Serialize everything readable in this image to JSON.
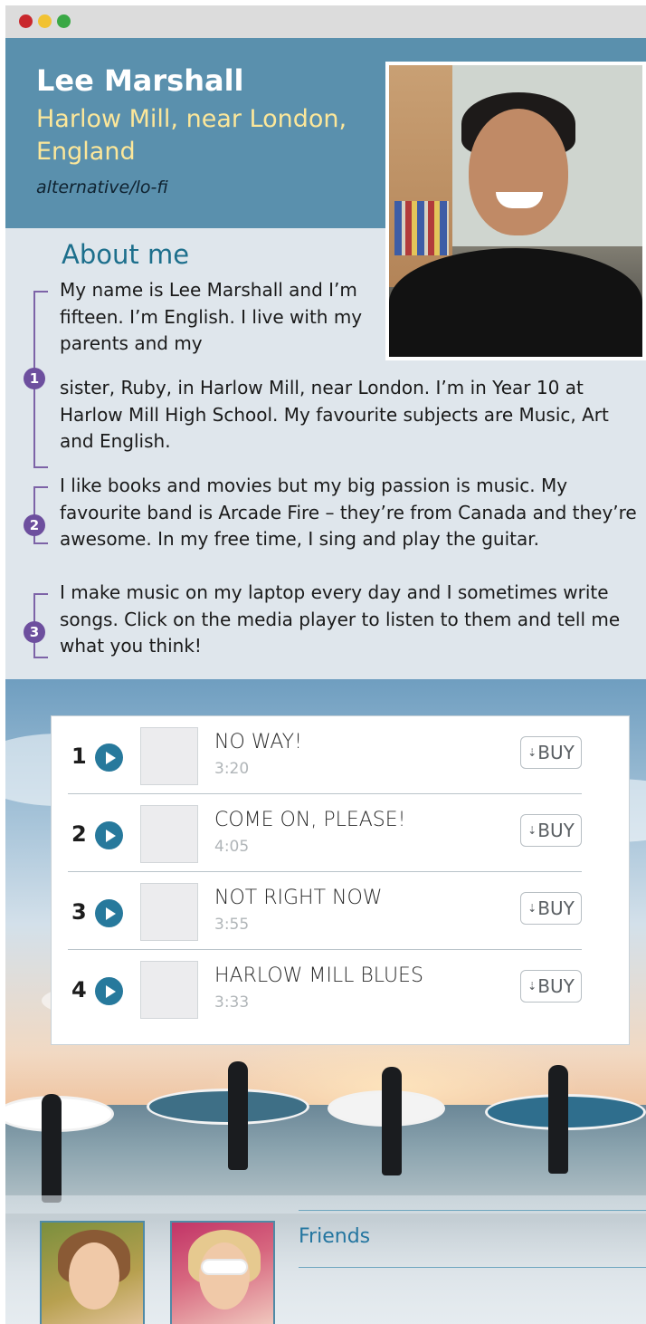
{
  "window": {
    "controls": [
      "close",
      "minimize",
      "maximize"
    ]
  },
  "profile": {
    "name": "Lee Marshall",
    "location": "Harlow Mill, near London, England",
    "genre": "alternative/lo-fi",
    "photo_icon": "profile-photo"
  },
  "about": {
    "title": "About me",
    "paragraphs": [
      {
        "number": "1",
        "text_a": "My name is Lee Marshall and I’m fifteen. I’m English. I live with my parents and my",
        "text_b": "sister, Ruby, in Harlow Mill, near London. I’m in Year 10 at Harlow Mill High School. My favourite subjects are Music, Art and English."
      },
      {
        "number": "2",
        "text": "I like books and movies but my big passion is music. My favourite band is Arcade Fire – they’re from Canada and they’re awesome. In my free time, I sing and play the guitar."
      },
      {
        "number": "3",
        "text": "I make music on my laptop every day and I sometimes write songs. Click on the media player to listen to them and tell me what you think!"
      }
    ]
  },
  "playlist": {
    "tracks": [
      {
        "number": "1",
        "title": "NO WAY!",
        "duration": "3:20",
        "buy_label": "BUY"
      },
      {
        "number": "2",
        "title": "COME ON, PLEASE!",
        "duration": "4:05",
        "buy_label": "BUY"
      },
      {
        "number": "3",
        "title": "NOT RIGHT NOW",
        "duration": "3:55",
        "buy_label": "BUY"
      },
      {
        "number": "4",
        "title": "HARLOW MILL BLUES",
        "duration": "3:33",
        "buy_label": "BUY"
      }
    ],
    "buy_arrow": "⇣"
  },
  "friends": {
    "label": "Friends",
    "photos": [
      "friend-photo-1",
      "friend-photo-2"
    ]
  },
  "colors": {
    "header_band": "#5a90ad",
    "location_text": "#fce79a",
    "accent_blue": "#27799c",
    "bracket_purple": "#6d4f9e"
  }
}
